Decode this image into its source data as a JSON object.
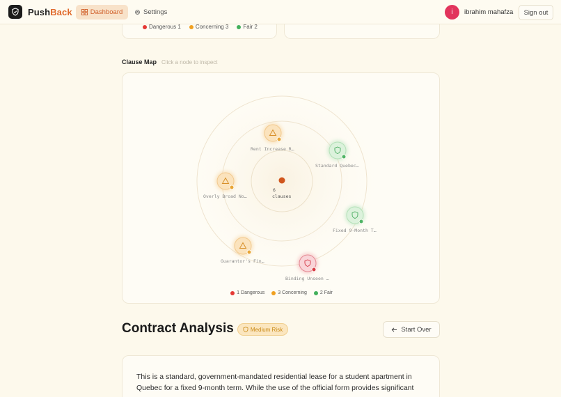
{
  "nav": {
    "brand_part1": "Push",
    "brand_part2": "Back",
    "dashboard_label": "Dashboard",
    "settings_label": "Settings",
    "avatar_initial": "i",
    "username": "ibrahim mahafza",
    "signout_label": "Sign out"
  },
  "top_legend": [
    {
      "label": "Dangerous 1",
      "color": "#e53935"
    },
    {
      "label": "Concerning 3",
      "color": "#f0a020"
    },
    {
      "label": "Fair 2",
      "color": "#43b05c"
    }
  ],
  "clause_map": {
    "title": "Clause Map",
    "hint": "Click a node to inspect",
    "center_count": "6",
    "center_unit": "clauses",
    "nodes": [
      {
        "label": "Rent Increase R…",
        "severity": "concerning",
        "icon": "warning-icon"
      },
      {
        "label": "Standard Quebec…",
        "severity": "fair",
        "icon": "shield-check-icon"
      },
      {
        "label": "Overly Broad No…",
        "severity": "concerning",
        "icon": "warning-icon"
      },
      {
        "label": "Fixed 9-Month T…",
        "severity": "fair",
        "icon": "shield-check-icon"
      },
      {
        "label": "Guarantor's Fin…",
        "severity": "concerning",
        "icon": "warning-icon"
      },
      {
        "label": "Binding Unseen …",
        "severity": "dangerous",
        "icon": "shield-alert-icon"
      }
    ],
    "legend": [
      {
        "label": "1 Dangerous",
        "color": "#e53935"
      },
      {
        "label": "3 Concerning",
        "color": "#f0a020"
      },
      {
        "label": "2 Fair",
        "color": "#43b05c"
      }
    ]
  },
  "analysis": {
    "title": "Contract Analysis",
    "risk_label": "Medium Risk",
    "start_over_label": "Start Over",
    "summary": "This is a standard, government-mandated residential lease for a student apartment in Quebec for a fixed 9-month term. While the use of the official form provides significant"
  }
}
